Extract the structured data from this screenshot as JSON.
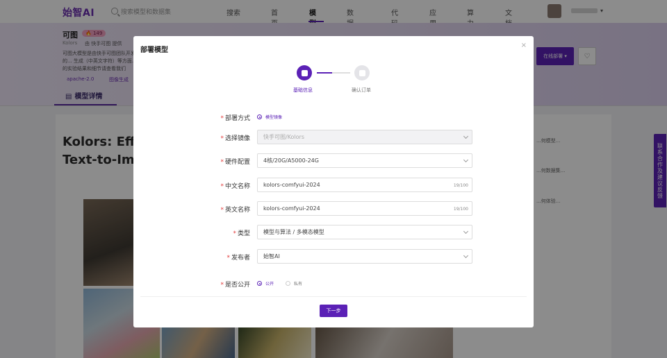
{
  "nav": {
    "logo": "始智AI",
    "search_placeholder": "搜索模型和数据集",
    "search_button": "搜索",
    "menu": [
      "首页",
      "模型",
      "数据集",
      "代码",
      "应用",
      "算力",
      "文档"
    ],
    "active_menu": "模型"
  },
  "model": {
    "title": "可图",
    "badge": "🔥 149",
    "org": "Kolors",
    "provider": "由 快手可图 提供",
    "desc": "可图大模型是由快手可图团队开发的... 生成（中英文字符）等方面... 的实验结果和细节请查看我们",
    "tags": [
      "apache-2.0",
      "图像生成"
    ],
    "tab_detail": "模型详情",
    "deploy_button": "在线部署",
    "heading": "Kolors: Effe... Text-to-Ima..."
  },
  "side_links": [
    "...何模型...",
    "...何数据集...",
    "...何体验..."
  ],
  "contact": "联系合作及建议反馈",
  "modal": {
    "title": "部署模型",
    "close": "×",
    "steps": [
      "基础信息",
      "确认订单"
    ],
    "labels": {
      "deploy_mode": "部署方式",
      "image": "选择镜像",
      "hardware": "硬件配置",
      "cn_name": "中文名称",
      "en_name": "英文名称",
      "type": "类型",
      "publisher": "发布者",
      "public": "是否公开"
    },
    "deploy_mode_option": "模型镜像",
    "image_value": "快手可图/Kolors",
    "hardware_value": "4核/20G/A5000-24G",
    "cn_name_value": "kolors-comfyui-2024",
    "cn_name_count": "19/100",
    "en_name_value": "kolors-comfyui-2024",
    "en_name_count": "19/100",
    "type_value": "模型与算法 / 多模态模型",
    "publisher_value": "始智AI",
    "public_options": [
      "公开",
      "私有"
    ],
    "next_button": "下一步"
  }
}
